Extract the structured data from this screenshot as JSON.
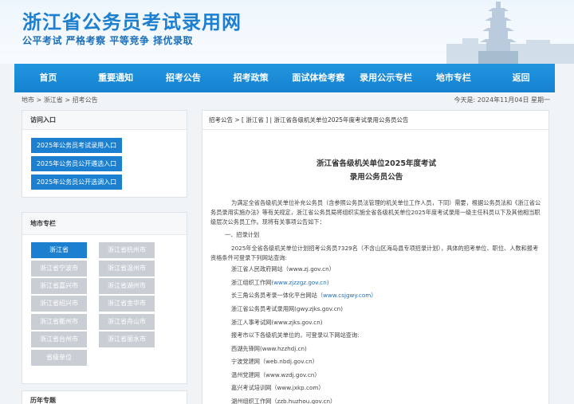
{
  "header": {
    "title": "浙江省公务员考试录用网",
    "slogan": "公平考试 严格考察 平等竞争 择优录取"
  },
  "nav": [
    "首页",
    "重要通知",
    "招考公告",
    "招考政策",
    "面试体检考察",
    "录用公示专栏",
    "地市专栏",
    "返回"
  ],
  "breadcrumb": "地市 > 浙江省 > 招考公告",
  "date_info": "今天是: 2024年11月04日 星期一",
  "access": {
    "title": "访问入口",
    "buttons": [
      "2025年公务员考试录用入口",
      "2025年公务员公开遴选入口",
      "2025年公务员公开选调入口"
    ]
  },
  "city": {
    "title": "地市专栏",
    "items": [
      "浙江省",
      "浙江省杭州市",
      "浙江省宁波市",
      "浙江省温州市",
      "浙江省嘉兴市",
      "浙江省湖州市",
      "浙江省绍兴市",
      "浙江省金华市",
      "浙江省衢州市",
      "浙江省舟山市",
      "浙江省台州市",
      "浙江省丽水市",
      "省级单位"
    ]
  },
  "history": {
    "title": "历年专题"
  },
  "article": {
    "crumb": "招考公告 > [ 浙江省 ] | 浙江省各级机关单位2025年度考试录用公务员公告",
    "title_line1": "浙江省各级机关单位2025年度考试",
    "title_line2": "录用公务员公告",
    "intro": "为满足全省各级机关单位补充公务员（含参照公务员法管理的机关单位工作人员，下同）需要，根据公务员法和《浙江省公务员录用实施办法》等有关规定，浙江省公务员局将组织实施全省各级机关单位2025年度考试录用一级主任科员以下及其他相当职级层次公务员工作。现将有关事项公告如下：",
    "section1": "一、招录计划",
    "plan": "2025年全省各级机关单位计划招考公务员7329名（不含山区海岛县专项招录计划），具体的招考单位、职位、人数和报考资格条件可登录下列网站查询:",
    "sites": [
      {
        "name": "浙江省人民政府网站",
        "url": "（www.zj.gov.cn）"
      },
      {
        "name": "浙江组织工作网",
        "url": "(www.zjzzgz.gov.cn)"
      },
      {
        "name": "长三角公务员考录一体化平台网站",
        "url": "（www.csjgwy.com）"
      },
      {
        "name": "浙江省公务员考试录用网",
        "url": "(gwy.zjks.gov.cn)"
      },
      {
        "name": "浙江人事考试网",
        "url": "(www.zjks.gov.cn)"
      }
    ],
    "city_intro": "报考市以下各级机关单位的，可登录以下网站查询:",
    "city_sites": [
      "西湖先锋网(www.hzzhdj.cn)",
      "宁波党建网（web.nbdj.gov.cn）",
      "温州党建网（www.wzdj.gov.cn）",
      "嘉兴考试培训网（www.jxkp.com）",
      "湖州组织工作网（zzb.huzhou.gov.cn）"
    ]
  }
}
